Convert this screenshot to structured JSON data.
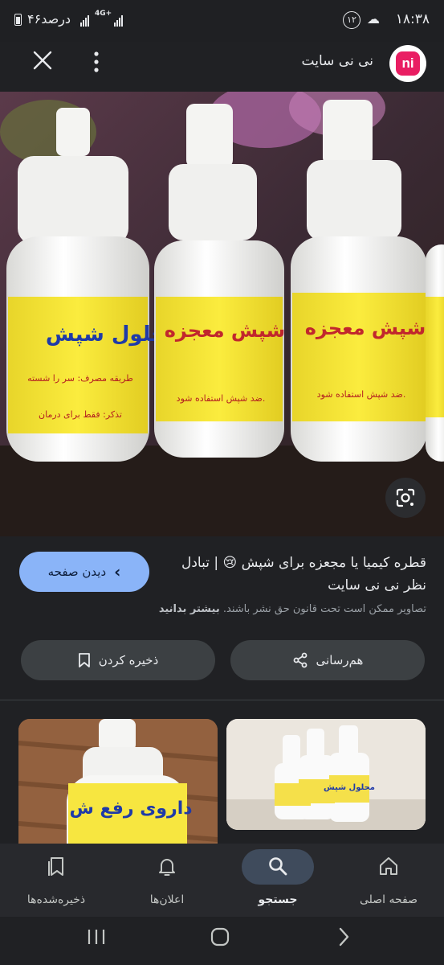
{
  "status_bar": {
    "time": "۱۸:۳۸",
    "notification_count": "۱۲",
    "battery_text": "۴۶درصد",
    "network": "4G+"
  },
  "header": {
    "logo_text": "ni",
    "site_name": "نی نی سایت"
  },
  "result": {
    "title": "قطره کیمیا یا مجعزه برای شپش 😢 | تبادل نظر نی نی سایت",
    "visit_button": "دیدن صفحه",
    "copyright_notice": "تصاویر ممکن است تحت قانون حق نشر باشند.",
    "learn_more": "بیشتر بدانید",
    "share_button": "هم‌رسانی",
    "save_button": "ذخیره کردن"
  },
  "bottom_nav": [
    {
      "label": "صفحه اصلی",
      "icon": "home-icon",
      "active": false
    },
    {
      "label": "جستجو",
      "icon": "search-icon",
      "active": true
    },
    {
      "label": "اعلان‌ها",
      "icon": "bell-icon",
      "active": false
    },
    {
      "label": "ذخیره‌شده‌ها",
      "icon": "bookmarks-icon",
      "active": false
    }
  ],
  "colors": {
    "background": "#202124",
    "accent": "#8ab4f8",
    "pill": "#3c4043",
    "brand": "#e91e63"
  }
}
